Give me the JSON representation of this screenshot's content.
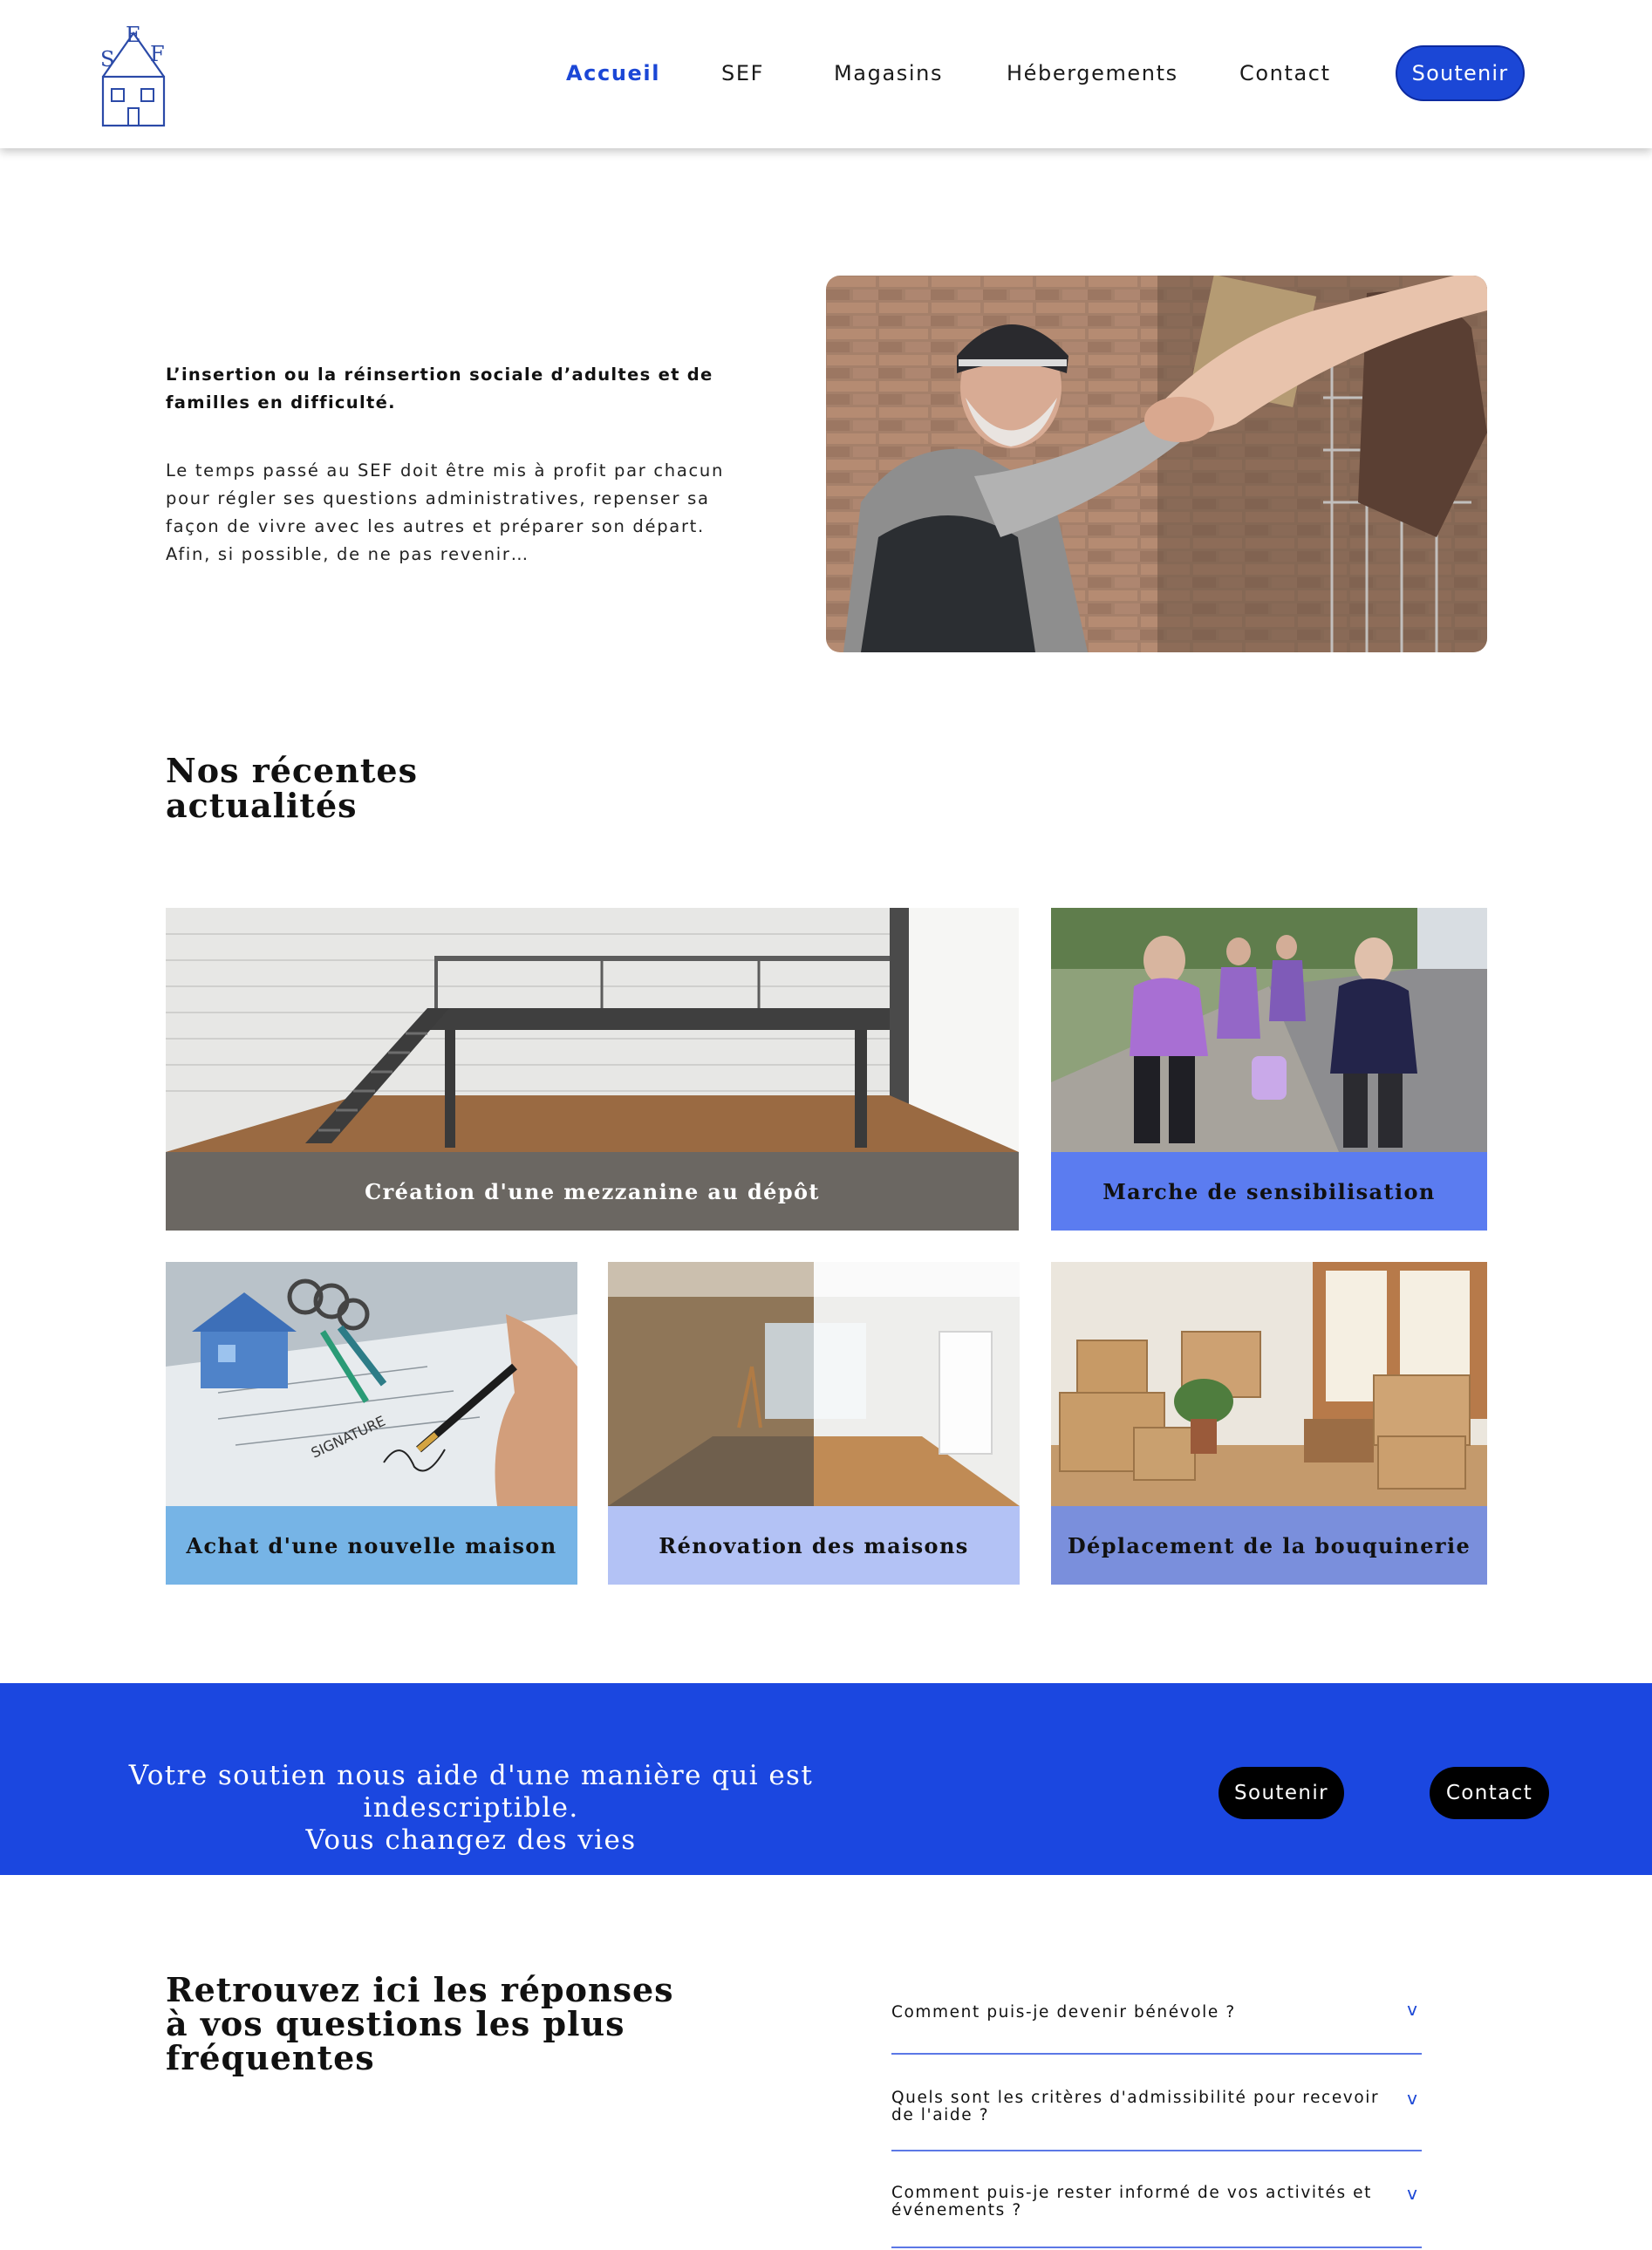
{
  "colors": {
    "accent": "#1b47d6",
    "banner": "#1b47e0",
    "caption_gray": "#6b6762",
    "caption_blue": "#5b7cf0",
    "caption_sky": "#76b4e6",
    "caption_periwinkle": "#b3c2f5",
    "caption_indigo": "#7a8fdc"
  },
  "logo": {
    "letters": [
      "S",
      "E",
      "F"
    ],
    "icon": "house-logo-icon"
  },
  "nav": {
    "items": [
      "Accueil",
      "SEF",
      "Magasins",
      "Hébergements",
      "Contact"
    ],
    "active": "Accueil",
    "cta": "Soutenir"
  },
  "hero": {
    "lead": "L’insertion ou la réinsertion sociale d’adultes et de familles en difficulté.",
    "body": "Le temps passé au SEF doit être mis à profit par chacun pour régler ses questions administratives, repenser sa façon de vivre avec les autres et préparer son départ. Afin, si possible, de ne pas revenir…",
    "image": "homeless-man-helping-hand-photo"
  },
  "news": {
    "title": "Nos récentes actualités",
    "cards": [
      {
        "label": "Création d'une mezzanine au dépôt",
        "image": "mezzanine-photo"
      },
      {
        "label": "Marche de sensibilisation",
        "image": "walk-photo"
      },
      {
        "label": "Achat d'une nouvelle maison",
        "image": "house-keys-signature-photo"
      },
      {
        "label": "Rénovation des maisons",
        "image": "renovation-photo"
      },
      {
        "label": "Déplacement de la bouquinerie",
        "image": "moving-boxes-photo"
      }
    ]
  },
  "banner": {
    "line1": "Votre soutien nous aide d'une manière qui est indescriptible.",
    "line2": "Vous changez des vies",
    "buttons": [
      "Soutenir",
      "Contact"
    ]
  },
  "faq": {
    "title": "Retrouvez ici les réponses à vos questions les plus fréquentes",
    "items": [
      {
        "question": "Comment puis-je devenir bénévole ?",
        "chevron": "v"
      },
      {
        "question": "Quels sont les critères d'admissibilité pour recevoir de l'aide ?",
        "chevron": "v"
      },
      {
        "question": "Comment puis-je rester informé de vos activités et événements ?",
        "chevron": "v"
      }
    ]
  }
}
